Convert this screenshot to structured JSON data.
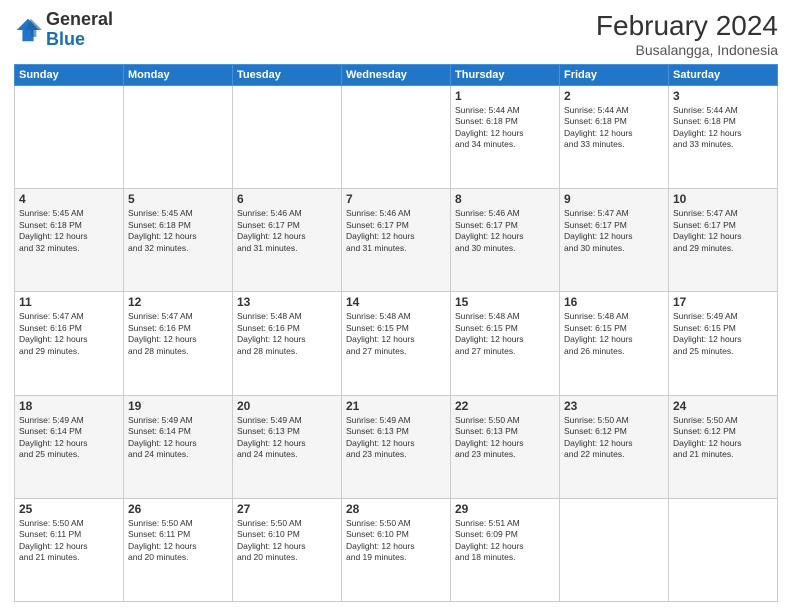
{
  "header": {
    "logo_general": "General",
    "logo_blue": "Blue",
    "month_year": "February 2024",
    "location": "Busalangga, Indonesia"
  },
  "days_of_week": [
    "Sunday",
    "Monday",
    "Tuesday",
    "Wednesday",
    "Thursday",
    "Friday",
    "Saturday"
  ],
  "weeks": [
    [
      {
        "day": "",
        "info": ""
      },
      {
        "day": "",
        "info": ""
      },
      {
        "day": "",
        "info": ""
      },
      {
        "day": "",
        "info": ""
      },
      {
        "day": "1",
        "info": "Sunrise: 5:44 AM\nSunset: 6:18 PM\nDaylight: 12 hours\nand 34 minutes."
      },
      {
        "day": "2",
        "info": "Sunrise: 5:44 AM\nSunset: 6:18 PM\nDaylight: 12 hours\nand 33 minutes."
      },
      {
        "day": "3",
        "info": "Sunrise: 5:44 AM\nSunset: 6:18 PM\nDaylight: 12 hours\nand 33 minutes."
      }
    ],
    [
      {
        "day": "4",
        "info": "Sunrise: 5:45 AM\nSunset: 6:18 PM\nDaylight: 12 hours\nand 32 minutes."
      },
      {
        "day": "5",
        "info": "Sunrise: 5:45 AM\nSunset: 6:18 PM\nDaylight: 12 hours\nand 32 minutes."
      },
      {
        "day": "6",
        "info": "Sunrise: 5:46 AM\nSunset: 6:17 PM\nDaylight: 12 hours\nand 31 minutes."
      },
      {
        "day": "7",
        "info": "Sunrise: 5:46 AM\nSunset: 6:17 PM\nDaylight: 12 hours\nand 31 minutes."
      },
      {
        "day": "8",
        "info": "Sunrise: 5:46 AM\nSunset: 6:17 PM\nDaylight: 12 hours\nand 30 minutes."
      },
      {
        "day": "9",
        "info": "Sunrise: 5:47 AM\nSunset: 6:17 PM\nDaylight: 12 hours\nand 30 minutes."
      },
      {
        "day": "10",
        "info": "Sunrise: 5:47 AM\nSunset: 6:17 PM\nDaylight: 12 hours\nand 29 minutes."
      }
    ],
    [
      {
        "day": "11",
        "info": "Sunrise: 5:47 AM\nSunset: 6:16 PM\nDaylight: 12 hours\nand 29 minutes."
      },
      {
        "day": "12",
        "info": "Sunrise: 5:47 AM\nSunset: 6:16 PM\nDaylight: 12 hours\nand 28 minutes."
      },
      {
        "day": "13",
        "info": "Sunrise: 5:48 AM\nSunset: 6:16 PM\nDaylight: 12 hours\nand 28 minutes."
      },
      {
        "day": "14",
        "info": "Sunrise: 5:48 AM\nSunset: 6:15 PM\nDaylight: 12 hours\nand 27 minutes."
      },
      {
        "day": "15",
        "info": "Sunrise: 5:48 AM\nSunset: 6:15 PM\nDaylight: 12 hours\nand 27 minutes."
      },
      {
        "day": "16",
        "info": "Sunrise: 5:48 AM\nSunset: 6:15 PM\nDaylight: 12 hours\nand 26 minutes."
      },
      {
        "day": "17",
        "info": "Sunrise: 5:49 AM\nSunset: 6:15 PM\nDaylight: 12 hours\nand 25 minutes."
      }
    ],
    [
      {
        "day": "18",
        "info": "Sunrise: 5:49 AM\nSunset: 6:14 PM\nDaylight: 12 hours\nand 25 minutes."
      },
      {
        "day": "19",
        "info": "Sunrise: 5:49 AM\nSunset: 6:14 PM\nDaylight: 12 hours\nand 24 minutes."
      },
      {
        "day": "20",
        "info": "Sunrise: 5:49 AM\nSunset: 6:13 PM\nDaylight: 12 hours\nand 24 minutes."
      },
      {
        "day": "21",
        "info": "Sunrise: 5:49 AM\nSunset: 6:13 PM\nDaylight: 12 hours\nand 23 minutes."
      },
      {
        "day": "22",
        "info": "Sunrise: 5:50 AM\nSunset: 6:13 PM\nDaylight: 12 hours\nand 23 minutes."
      },
      {
        "day": "23",
        "info": "Sunrise: 5:50 AM\nSunset: 6:12 PM\nDaylight: 12 hours\nand 22 minutes."
      },
      {
        "day": "24",
        "info": "Sunrise: 5:50 AM\nSunset: 6:12 PM\nDaylight: 12 hours\nand 21 minutes."
      }
    ],
    [
      {
        "day": "25",
        "info": "Sunrise: 5:50 AM\nSunset: 6:11 PM\nDaylight: 12 hours\nand 21 minutes."
      },
      {
        "day": "26",
        "info": "Sunrise: 5:50 AM\nSunset: 6:11 PM\nDaylight: 12 hours\nand 20 minutes."
      },
      {
        "day": "27",
        "info": "Sunrise: 5:50 AM\nSunset: 6:10 PM\nDaylight: 12 hours\nand 20 minutes."
      },
      {
        "day": "28",
        "info": "Sunrise: 5:50 AM\nSunset: 6:10 PM\nDaylight: 12 hours\nand 19 minutes."
      },
      {
        "day": "29",
        "info": "Sunrise: 5:51 AM\nSunset: 6:09 PM\nDaylight: 12 hours\nand 18 minutes."
      },
      {
        "day": "",
        "info": ""
      },
      {
        "day": "",
        "info": ""
      }
    ]
  ]
}
